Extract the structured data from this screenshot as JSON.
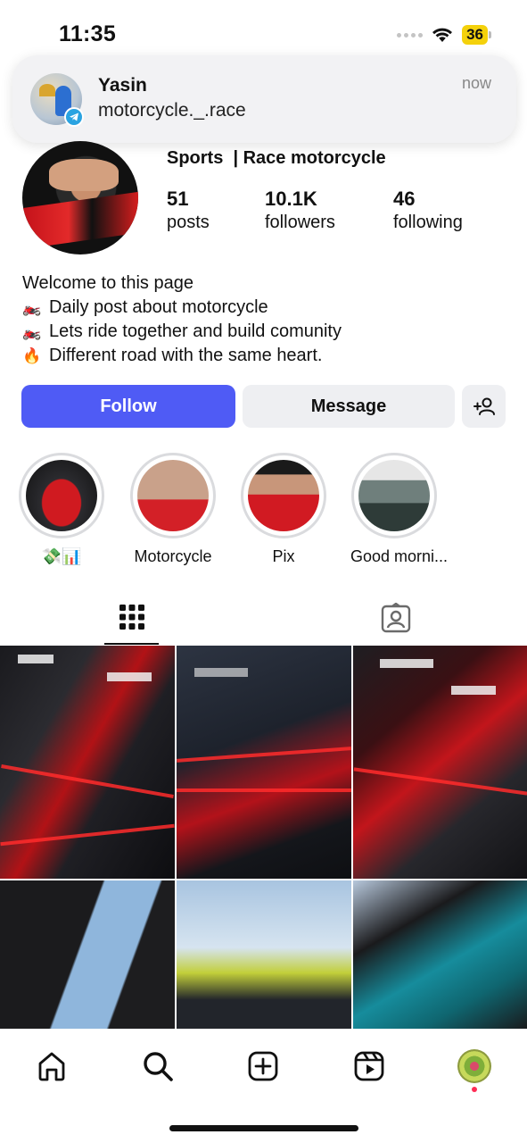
{
  "status_bar": {
    "time": "11:35",
    "battery": "36"
  },
  "notification": {
    "sender": "Yasin",
    "message": "motorcycle._.race",
    "time": "now",
    "app_icon": "telegram-icon"
  },
  "profile": {
    "category": "Sports  | Race motorcycle",
    "stats": [
      {
        "value": "51",
        "label": "posts"
      },
      {
        "value": "10.1K",
        "label": "followers"
      },
      {
        "value": "46",
        "label": "following"
      }
    ],
    "bio": [
      {
        "icon": "🏍️",
        "text": "Welcome to this page"
      },
      {
        "icon": "🏍️",
        "text": "Daily post about motorcycle"
      },
      {
        "icon": "🏍️",
        "text": "Lets ride together and build comunity"
      },
      {
        "icon": "🔥",
        "text": "Different road with the same heart."
      }
    ]
  },
  "actions": {
    "follow": "Follow",
    "message": "Message"
  },
  "highlights": [
    {
      "label": "💸📊"
    },
    {
      "label": "Motorcycle"
    },
    {
      "label": "Pix"
    },
    {
      "label": "Good morni..."
    }
  ],
  "tabs": [
    "grid-icon",
    "tagged-icon"
  ],
  "bottom_nav": [
    "home-icon",
    "search-icon",
    "create-icon",
    "reels-icon",
    "profile-avatar"
  ],
  "colors": {
    "accent": "#4f5bf5",
    "secondary_button": "#eeeff2",
    "notification_bg": "#f2f2f4"
  }
}
